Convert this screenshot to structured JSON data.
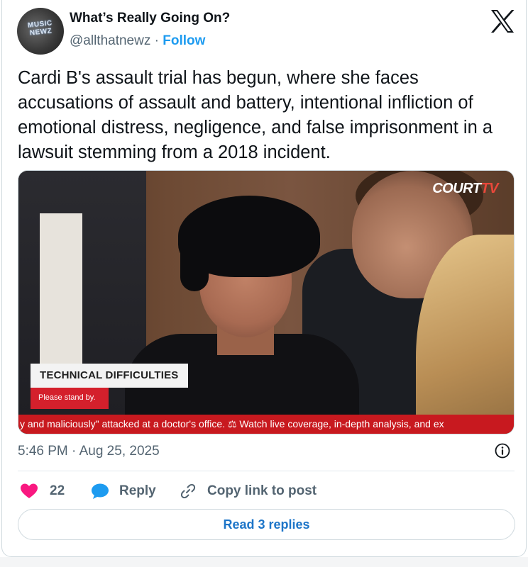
{
  "author": {
    "name": "What’s Really Going On?",
    "handle": "@allthatnewz",
    "separator": "·",
    "follow_label": "Follow",
    "avatar_text": "MUSIC NEWZ"
  },
  "tweet": {
    "text": "Cardi B's assault trial has begun, where she faces accusations of assault and battery, intentional infliction of emotional distress, negligence, and false imprisonment in a lawsuit stemming from a 2018 incident."
  },
  "media": {
    "logo_text": "COURT",
    "logo_tv": "TV",
    "banner_title": "TECHNICAL DIFFICULTIES",
    "banner_sub": "Please stand by.",
    "ticker": "y and maliciously\" attacked at a doctor's office.  ⚖  Watch live coverage, in-depth analysis, and ex"
  },
  "meta": {
    "timestamp": "5:46 PM · Aug 25, 2025"
  },
  "actions": {
    "like_count": "22",
    "reply_label": "Reply",
    "copy_label": "Copy link to post",
    "read_replies_label": "Read 3 replies"
  },
  "colors": {
    "accent": "#1d9bf0",
    "heart": "#f91880",
    "text": "#0f1419",
    "secondary": "#536471"
  },
  "icons": [
    "x-logo-icon",
    "info-icon",
    "heart-icon",
    "reply-bubble-icon",
    "link-icon"
  ]
}
